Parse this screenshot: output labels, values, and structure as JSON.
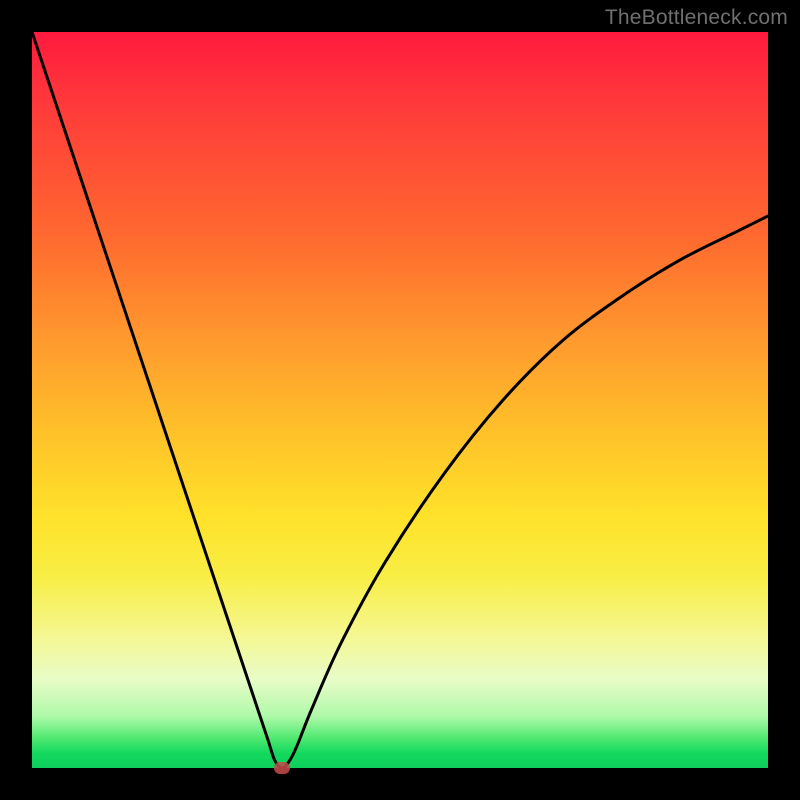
{
  "watermark": "TheBottleneck.com",
  "chart_data": {
    "type": "line",
    "title": "",
    "xlabel": "",
    "ylabel": "",
    "xlim": [
      0,
      100
    ],
    "ylim": [
      0,
      100
    ],
    "grid": false,
    "legend": false,
    "series": [
      {
        "name": "bottleneck-curve",
        "x": [
          0,
          4,
          8,
          12,
          16,
          20,
          24,
          28,
          30,
          32,
          33,
          34,
          35,
          36,
          38,
          42,
          48,
          56,
          64,
          72,
          80,
          88,
          96,
          100
        ],
        "y": [
          100,
          88,
          76,
          64,
          52,
          40,
          28,
          16,
          10,
          4,
          1,
          0,
          1,
          3,
          8,
          17,
          28,
          40,
          50,
          58,
          64,
          69,
          73,
          75
        ]
      }
    ],
    "marker": {
      "x": 34,
      "y": 0
    },
    "gradient_stops": [
      {
        "pos": 0,
        "color": "#ff1a3e"
      },
      {
        "pos": 10,
        "color": "#ff3a3a"
      },
      {
        "pos": 28,
        "color": "#ff6a2f"
      },
      {
        "pos": 42,
        "color": "#ff9a2e"
      },
      {
        "pos": 55,
        "color": "#ffc329"
      },
      {
        "pos": 66,
        "color": "#ffe22a"
      },
      {
        "pos": 74,
        "color": "#f8ee45"
      },
      {
        "pos": 82,
        "color": "#f5f791"
      },
      {
        "pos": 88,
        "color": "#e8fcc8"
      },
      {
        "pos": 93,
        "color": "#aef9a8"
      },
      {
        "pos": 96,
        "color": "#4ee870"
      },
      {
        "pos": 98,
        "color": "#13d95e"
      },
      {
        "pos": 100,
        "color": "#0fce5d"
      }
    ]
  }
}
